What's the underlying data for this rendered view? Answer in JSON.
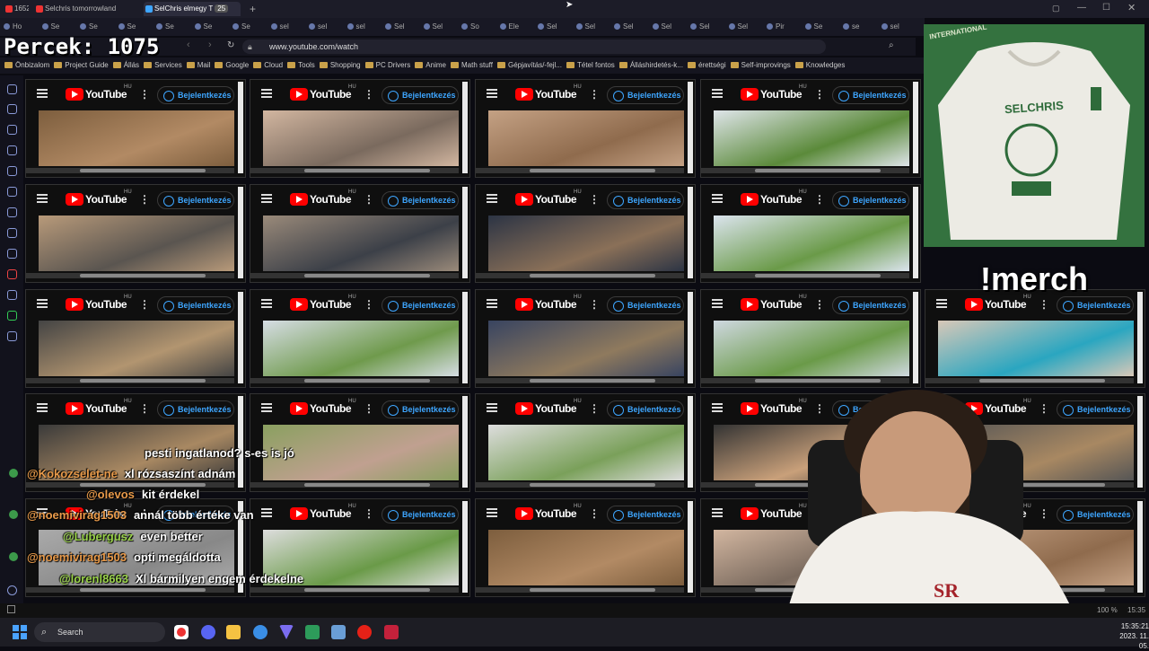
{
  "browser": {
    "tabs": [
      {
        "label": "1652"
      },
      {
        "label": "Selchris tomorrowland"
      },
      {
        "label": "SelChris elmegy T",
        "count": "25",
        "active": true
      }
    ],
    "row2_tabs": [
      "Ho",
      "Se",
      "Se",
      "Se",
      "Se",
      "Se",
      "Se",
      "sel",
      "sel",
      "sel",
      "Sel",
      "Sel",
      "So",
      "Ele",
      "Sel",
      "Sel",
      "Sel",
      "Sel",
      "Sel",
      "Sel",
      "Pir",
      "Se",
      "se",
      "sel"
    ],
    "url": "www.youtube.com/watch",
    "bookmarks": [
      "Önbizalom",
      "Project Guide",
      "Állás",
      "Services",
      "Mail",
      "Google",
      "Cloud",
      "Tools",
      "Shopping",
      "PC Drivers",
      "Anime",
      "Math stuff",
      "Gépjavítás/-fejl...",
      "Tétel fontos",
      "Álláshirdetés-k...",
      "érettségi",
      "Self-improvings",
      "Knowledges"
    ],
    "zoom": "100 %",
    "status_time": "15:35"
  },
  "overlay": {
    "counter": "Percek: 1075",
    "merch_command": "!merch",
    "merch_brand": "SELCHRIS",
    "merch_badge": "INTERNATIONAL"
  },
  "youtube": {
    "logo_text": "YouTube",
    "region": "HU",
    "login_label": "Bejelentkezés"
  },
  "chat": [
    {
      "user": "",
      "text": "pesti ingatlanod? s-es is jó"
    },
    {
      "user": "@Kokozselet-ne",
      "text": "xl rózsaszínt adnám"
    },
    {
      "user": "@olevos",
      "text": "kit érdekel"
    },
    {
      "user": "@noemivirag1503",
      "text": "annál több értéke van"
    },
    {
      "user": "@Lubergusz",
      "text": "even better"
    },
    {
      "user": "@noemivirag1503",
      "text": "opti megáldotta"
    },
    {
      "user": "@lorenl8663",
      "text": "Xl bármilyen engem érdekelne"
    }
  ],
  "taskbar": {
    "search": "Search",
    "time": "15:35:21",
    "date": "2023. 11. 05."
  },
  "colors": {
    "youtube_red": "#ff0000",
    "link_blue": "#3ea6ff",
    "merch_green": "#2e6b3a"
  }
}
